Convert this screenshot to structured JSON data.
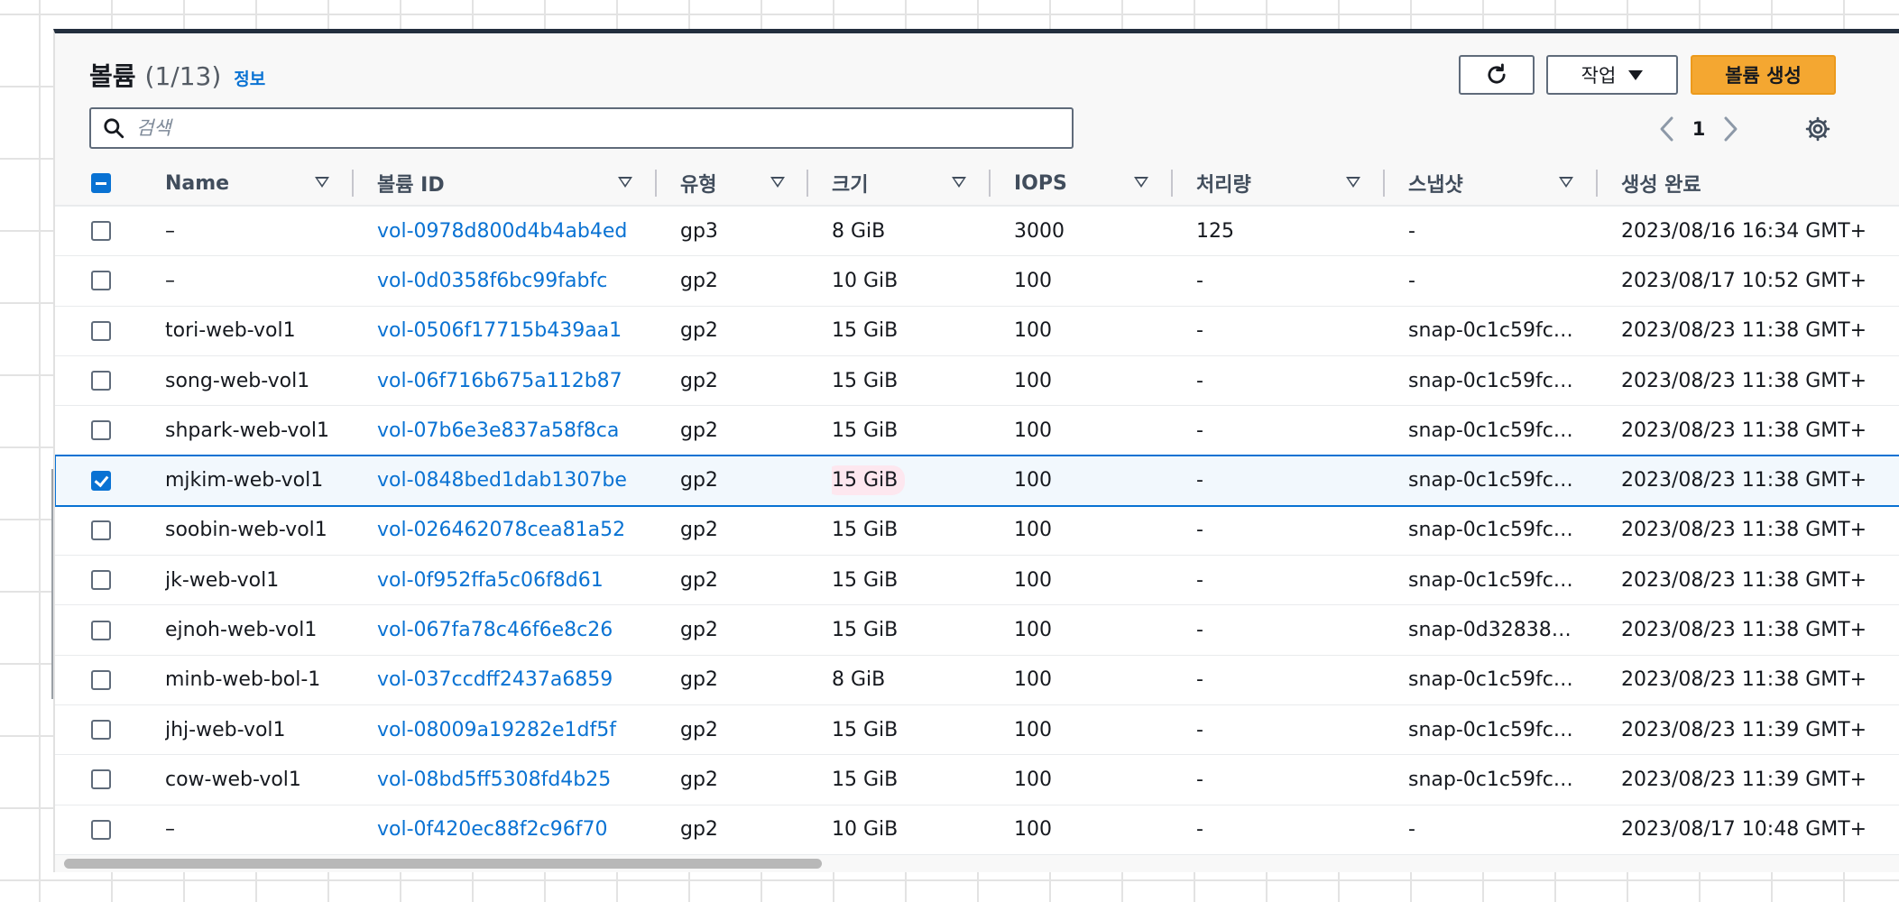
{
  "header": {
    "title": "볼륨",
    "count": "(1/13)",
    "info_link": "정보"
  },
  "toolbar": {
    "refresh_icon": "refresh-icon",
    "actions_label": "작업",
    "create_label": "볼륨 생성",
    "create_color": "#f4a731"
  },
  "search": {
    "placeholder": "검색",
    "value": ""
  },
  "pagination": {
    "current_page": "1"
  },
  "table": {
    "columns": [
      "Name",
      "볼륨 ID",
      "유형",
      "크기",
      "IOPS",
      "처리량",
      "스냅샷",
      "생성 완료"
    ],
    "rows": [
      {
        "selected": false,
        "name": "–",
        "volume_id": "vol-0978d800d4b4ab4ed",
        "type": "gp3",
        "size": "8 GiB",
        "iops": "3000",
        "throughput": "125",
        "snapshot": "-",
        "created": "2023/08/16 16:34 GMT+"
      },
      {
        "selected": false,
        "name": "–",
        "volume_id": "vol-0d0358f6bc99fabfc",
        "type": "gp2",
        "size": "10 GiB",
        "iops": "100",
        "throughput": "-",
        "snapshot": "-",
        "created": "2023/08/17 10:52 GMT+"
      },
      {
        "selected": false,
        "name": "tori-web-vol1",
        "volume_id": "vol-0506f17715b439aa1",
        "type": "gp2",
        "size": "15 GiB",
        "iops": "100",
        "throughput": "-",
        "snapshot": "snap-0c1c59fc…",
        "created": "2023/08/23 11:38 GMT+"
      },
      {
        "selected": false,
        "name": "song-web-vol1",
        "volume_id": "vol-06f716b675a112b87",
        "type": "gp2",
        "size": "15 GiB",
        "iops": "100",
        "throughput": "-",
        "snapshot": "snap-0c1c59fc…",
        "created": "2023/08/23 11:38 GMT+"
      },
      {
        "selected": false,
        "name": "shpark-web-vol1",
        "volume_id": "vol-07b6e3e837a58f8ca",
        "type": "gp2",
        "size": "15 GiB",
        "iops": "100",
        "throughput": "-",
        "snapshot": "snap-0c1c59fc…",
        "created": "2023/08/23 11:38 GMT+"
      },
      {
        "selected": true,
        "name": "mjkim-web-vol1",
        "volume_id": "vol-0848bed1dab1307be",
        "type": "gp2",
        "size": "15 GiB",
        "iops": "100",
        "throughput": "-",
        "snapshot": "snap-0c1c59fc…",
        "created": "2023/08/23 11:38 GMT+"
      },
      {
        "selected": false,
        "name": "soobin-web-vol1",
        "volume_id": "vol-026462078cea81a52",
        "type": "gp2",
        "size": "15 GiB",
        "iops": "100",
        "throughput": "-",
        "snapshot": "snap-0c1c59fc…",
        "created": "2023/08/23 11:38 GMT+"
      },
      {
        "selected": false,
        "name": "jk-web-vol1",
        "volume_id": "vol-0f952ffa5c06f8d61",
        "type": "gp2",
        "size": "15 GiB",
        "iops": "100",
        "throughput": "-",
        "snapshot": "snap-0c1c59fc…",
        "created": "2023/08/23 11:38 GMT+"
      },
      {
        "selected": false,
        "name": "ejnoh-web-vol1",
        "volume_id": "vol-067fa78c46f6e8c26",
        "type": "gp2",
        "size": "15 GiB",
        "iops": "100",
        "throughput": "-",
        "snapshot": "snap-0d32838…",
        "created": "2023/08/23 11:38 GMT+"
      },
      {
        "selected": false,
        "name": "minb-web-bol-1",
        "volume_id": "vol-037ccdff2437a6859",
        "type": "gp2",
        "size": "8 GiB",
        "iops": "100",
        "throughput": "-",
        "snapshot": "snap-0c1c59fc…",
        "created": "2023/08/23 11:38 GMT+"
      },
      {
        "selected": false,
        "name": "jhj-web-vol1",
        "volume_id": "vol-08009a19282e1df5f",
        "type": "gp2",
        "size": "15 GiB",
        "iops": "100",
        "throughput": "-",
        "snapshot": "snap-0c1c59fc…",
        "created": "2023/08/23 11:39 GMT+"
      },
      {
        "selected": false,
        "name": "cow-web-vol1",
        "volume_id": "vol-08bd5ff5308fd4b25",
        "type": "gp2",
        "size": "15 GiB",
        "iops": "100",
        "throughput": "-",
        "snapshot": "snap-0c1c59fc…",
        "created": "2023/08/23 11:39 GMT+"
      },
      {
        "selected": false,
        "name": "–",
        "volume_id": "vol-0f420ec88f2c96f70",
        "type": "gp2",
        "size": "10 GiB",
        "iops": "100",
        "throughput": "-",
        "snapshot": "-",
        "created": "2023/08/17 10:48 GMT+"
      }
    ]
  },
  "colors": {
    "link": "#0972d3",
    "selected_outline": "#0972d3",
    "selected_background": "#f2f8fd",
    "size_highlight": "#fde7ef",
    "top_bar": "#232f3e"
  }
}
